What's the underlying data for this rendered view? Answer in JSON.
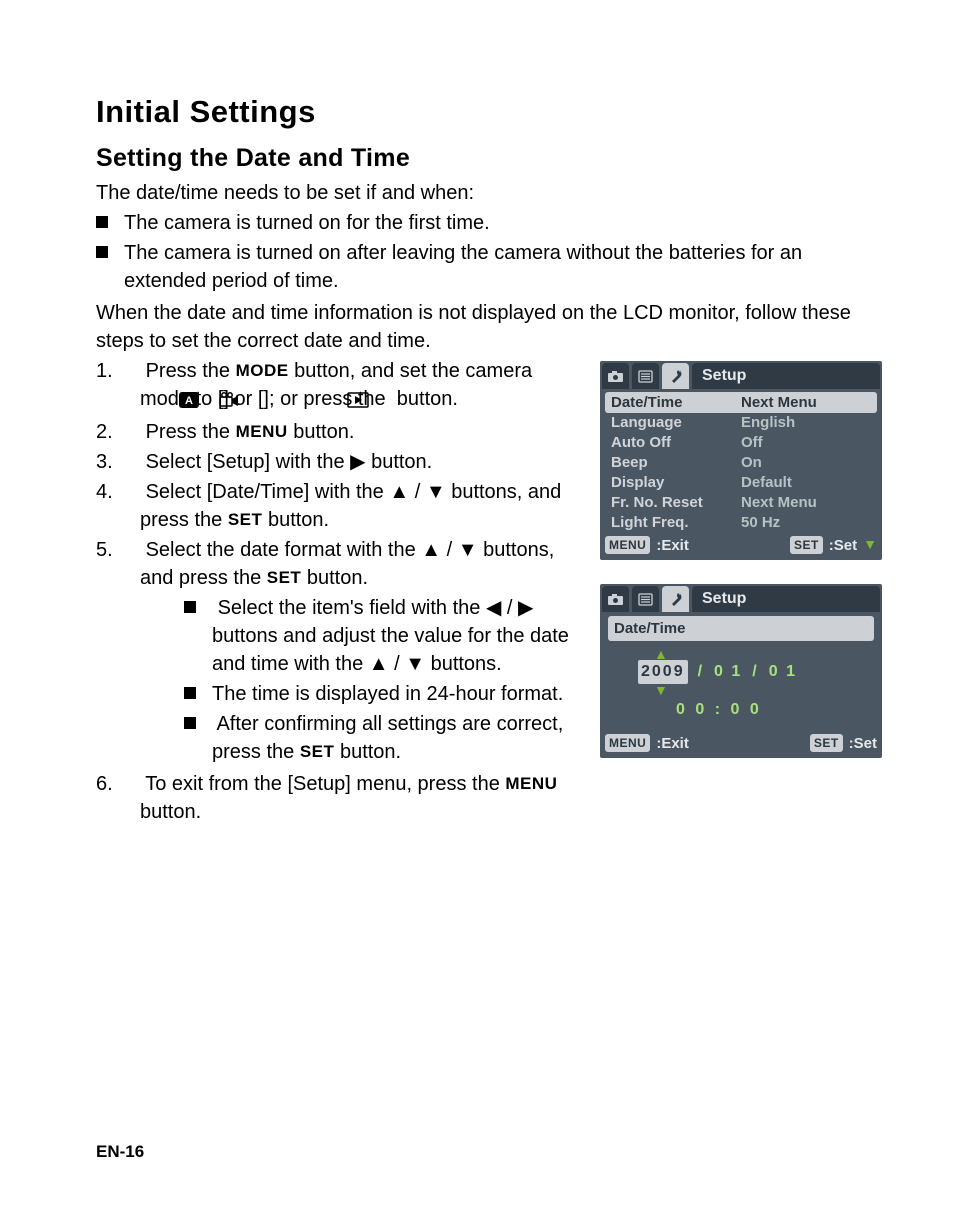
{
  "headings": {
    "h1": "Initial Settings",
    "h2": "Setting the Date and Time"
  },
  "intro": "The date/time needs to be set if and when:",
  "intro_bullets": [
    "The camera is turned on for the first time.",
    "The camera is turned on after leaving the camera without the batteries for an extended period of time."
  ],
  "intro2": "When the date and time information is not displayed on the LCD monitor, follow these steps to set the correct date and time.",
  "labels": {
    "mode": "MODE",
    "menu": "MENU",
    "set": "SET"
  },
  "steps": {
    "s1a": "Press the ",
    "s1b": " button, and set the camera mode to [",
    "s1c": "] or [",
    "s1d": "]; or press the ",
    "s1e": " button.",
    "s2a": "Press the ",
    "s2b": " button.",
    "s3a": "Select [Setup] with the ",
    "s3b": " button.",
    "s4a": "Select [Date/Time] with the ",
    "s4b": " buttons, and press the ",
    "s4c": " button.",
    "s5a": "Select the date format with the ",
    "s5b": " buttons, and press the ",
    "s5c": " button.",
    "s5_b1a": "Select the item's field with the ",
    "s5_b1b": " buttons and adjust the value for the date and time with the ",
    "s5_b1c": " buttons.",
    "s5_b2": "The time is displayed in 24-hour format.",
    "s5_b3a": "After confirming all settings are correct, press the ",
    "s5_b3b": " button.",
    "s6a": "To exit from the [Setup] menu, press the ",
    "s6b": " button."
  },
  "glyphs": {
    "tri_right": "▶",
    "tri_left": "◀",
    "tri_up": "▲",
    "tri_down": "▼",
    "slash": " / "
  },
  "lcd1": {
    "title": "Setup",
    "rows": [
      {
        "left": "Date/Time",
        "right": "Next Menu",
        "selected": true
      },
      {
        "left": "Language",
        "right": "English"
      },
      {
        "left": "Auto Off",
        "right": "Off"
      },
      {
        "left": "Beep",
        "right": "On"
      },
      {
        "left": "Display",
        "right": "Default"
      },
      {
        "left": "Fr. No. Reset",
        "right": "Next Menu"
      },
      {
        "left": "Light Freq.",
        "right": "50 Hz"
      }
    ],
    "footer": {
      "menu": "MENU",
      "exit": ":Exit",
      "set": "SET",
      "setlbl": ":Set"
    }
  },
  "lcd2": {
    "title": "Setup",
    "subtitle": "Date/Time",
    "year": "2009",
    "month": "0 1",
    "day": "0 1",
    "hour": "0 0",
    "minute": "0 0",
    "sep": "/",
    "colon": ":",
    "footer": {
      "menu": "MENU",
      "exit": ":Exit",
      "set": "SET",
      "setlbl": ":Set"
    }
  },
  "page_number": "EN-16"
}
